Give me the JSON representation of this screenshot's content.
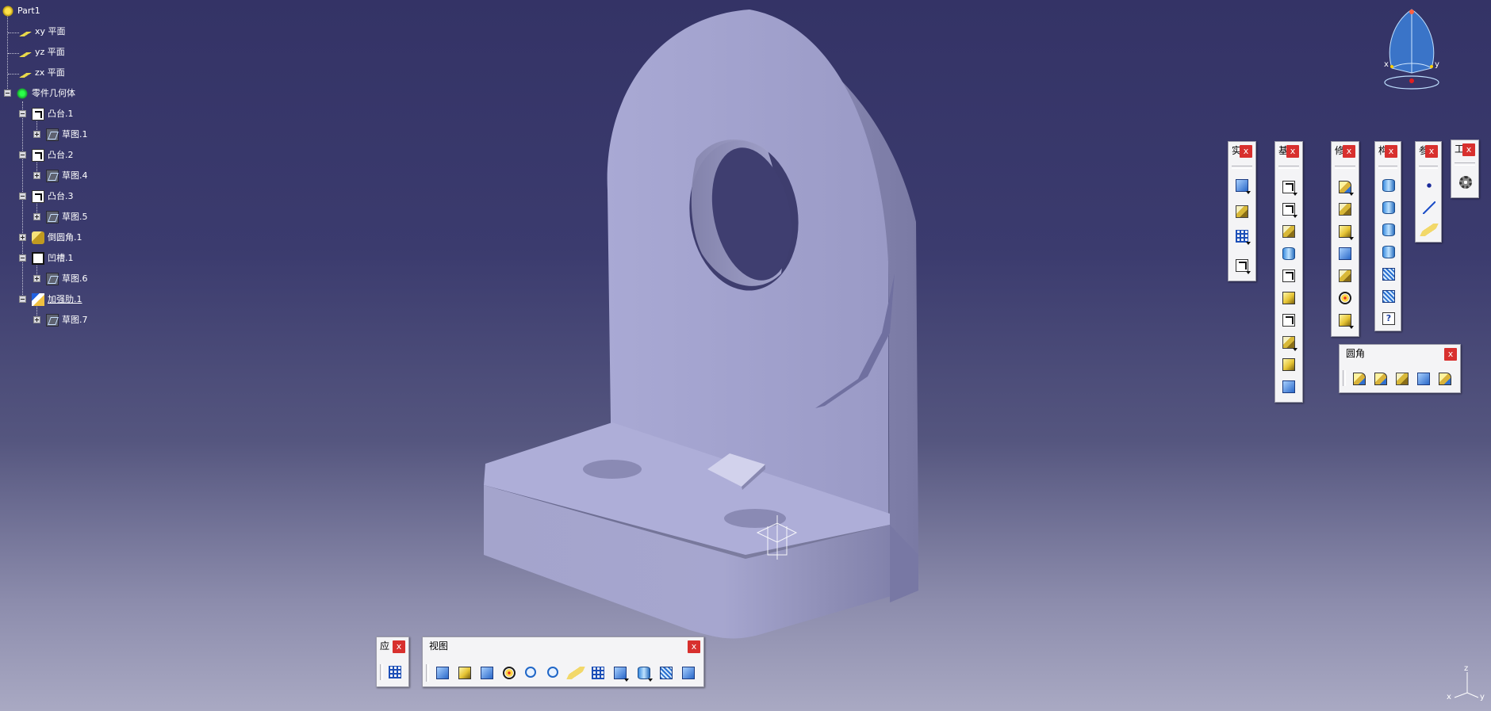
{
  "tree": {
    "root": "Part1",
    "planes": [
      "xy 平面",
      "yz 平面",
      "zx 平面"
    ],
    "body": "零件几何体",
    "features": [
      {
        "label": "凸台.1",
        "icon": "pad-icon",
        "child": "草图.1"
      },
      {
        "label": "凸台.2",
        "icon": "pad-icon",
        "child": "草图.4"
      },
      {
        "label": "凸台.3",
        "icon": "pad-icon",
        "child": "草图.5"
      },
      {
        "label": "倒圆角.1",
        "icon": "fillet-icon",
        "child": null
      },
      {
        "label": "凹槽.1",
        "icon": "pocket-icon",
        "child": "草图.6"
      },
      {
        "label": "加强肋.1",
        "icon": "rib-icon",
        "child": "草图.7"
      }
    ]
  },
  "compass": {
    "x": "x",
    "y": "y"
  },
  "axis_triad": {
    "x": "x",
    "y": "y",
    "z": "z"
  },
  "toolbars": {
    "app": {
      "title": "应",
      "close": "x"
    },
    "view": {
      "title": "视图",
      "close": "x"
    },
    "t1": {
      "title": "实",
      "close": "x"
    },
    "t2": {
      "title": "基",
      "close": "x"
    },
    "t3": {
      "title": "修",
      "close": "x"
    },
    "t4": {
      "title": "构",
      "close": "x"
    },
    "t5": {
      "title": "参",
      "close": "x"
    },
    "t6": {
      "title": "工",
      "close": "x"
    },
    "fillet": {
      "title": "圆角",
      "close": "x"
    }
  },
  "colors": {
    "bg_top": "#343366",
    "bg_bottom": "#a9a9c3",
    "part_light": "#b1b1d8",
    "part_shade": "#8c8cb4",
    "close_red": "#d8302e"
  }
}
